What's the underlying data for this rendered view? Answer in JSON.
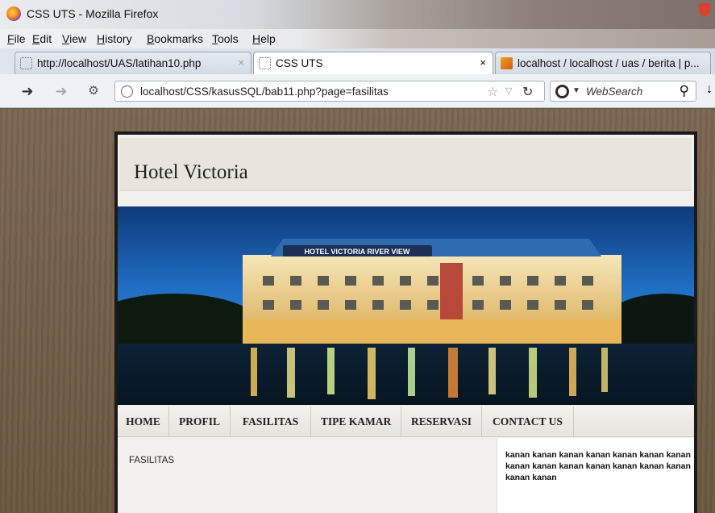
{
  "window": {
    "title": "CSS UTS - Mozilla Firefox"
  },
  "menu": [
    "File",
    "Edit",
    "View",
    "History",
    "Bookmarks",
    "Tools",
    "Help"
  ],
  "tabs": [
    {
      "label": "http://localhost/UAS/latihan10.php",
      "close": "×"
    },
    {
      "label": "CSS UTS",
      "close": "×"
    },
    {
      "label": "localhost / localhost / uas / berita | p..."
    }
  ],
  "toolbar": {
    "url": "localhost/CSS/kasusSQL/bab11.php?page=fasilitas",
    "search_placeholder": "WebSearch"
  },
  "site": {
    "title": "Hotel Victoria",
    "banner_sign": "HOTEL VICTORIA RIVER VIEW",
    "nav": [
      "HOME",
      "PROFIL",
      "FASILITAS",
      "TIPE KAMAR",
      "RESERVASI",
      "CONTACT US"
    ],
    "content_title": "FASILITAS",
    "sidebar_text": "kanan kanan kanan kanan kanan kanan kanan kanan kanan kanan kanan kanan kanan kanan kanan kanan"
  },
  "colors": {
    "accent": "#2a2a2a",
    "page_bg": "#6b5a45"
  }
}
